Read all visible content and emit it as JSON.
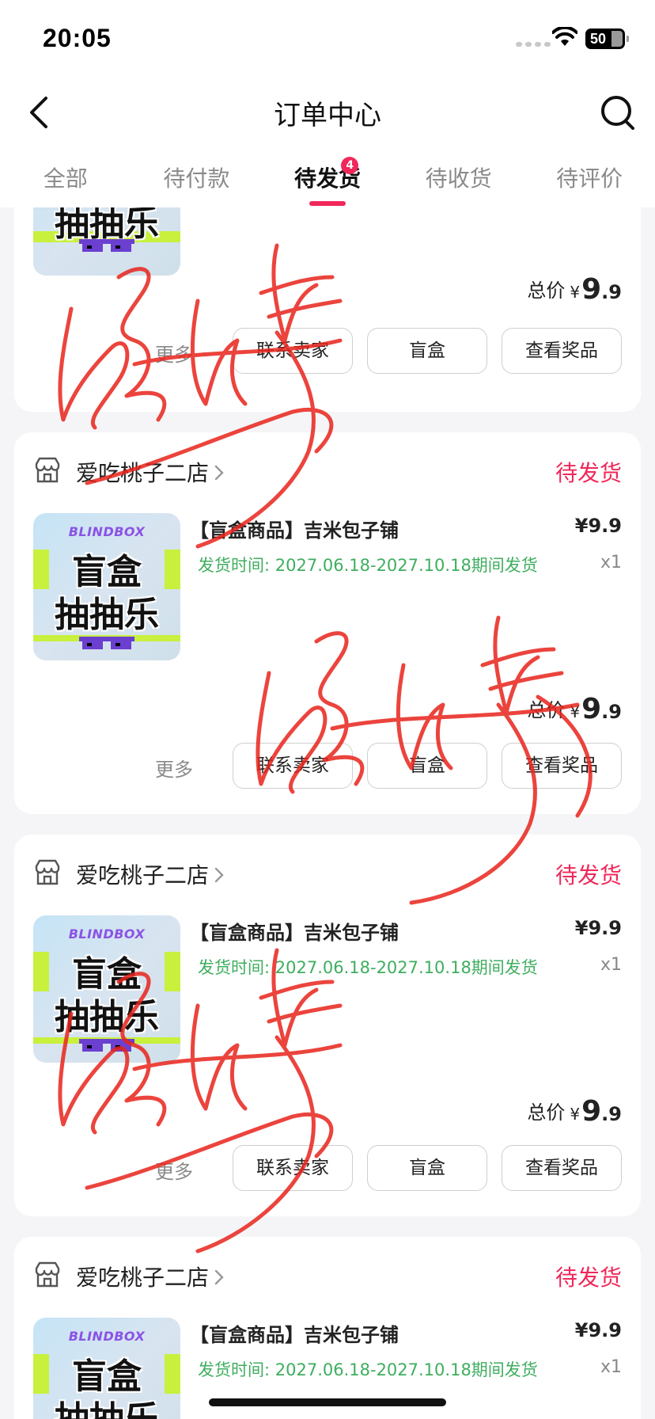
{
  "status_bar": {
    "time": "20:05",
    "battery_level": "50"
  },
  "nav": {
    "title": "订单中心"
  },
  "tabs": [
    {
      "label": "全部",
      "active": false
    },
    {
      "label": "待付款",
      "active": false
    },
    {
      "label": "待发货",
      "active": true,
      "badge": "4"
    },
    {
      "label": "待收货",
      "active": false
    },
    {
      "label": "待评价",
      "active": false
    }
  ],
  "thumb": {
    "brand": "BLINDBOX",
    "line1": "盲盒",
    "line2": "抽抽乐"
  },
  "orders": [
    {
      "total_label": "总价",
      "currency": "¥",
      "total_int": "9",
      "total_dec": ".9",
      "more": "更多",
      "buttons": [
        "联系卖家",
        "盲盒",
        "查看奖品"
      ]
    },
    {
      "shop": "爱吃桃子二店",
      "status": "待发货",
      "title": "【盲盒商品】吉米包子铺",
      "price": "¥9.9",
      "ship_time": "发货时间: 2027.06.18-2027.10.18期间发货",
      "qty": "x1",
      "total_label": "总价",
      "currency": "¥",
      "total_int": "9",
      "total_dec": ".9",
      "more": "更多",
      "buttons": [
        "联系卖家",
        "盲盒",
        "查看奖品"
      ]
    },
    {
      "shop": "爱吃桃子二店",
      "status": "待发货",
      "title": "【盲盒商品】吉米包子铺",
      "price": "¥9.9",
      "ship_time": "发货时间: 2027.06.18-2027.10.18期间发货",
      "qty": "x1",
      "total_label": "总价",
      "currency": "¥",
      "total_int": "9",
      "total_dec": ".9",
      "more": "更多",
      "buttons": [
        "联系卖家",
        "盲盒",
        "查看奖品"
      ]
    },
    {
      "shop": "爱吃桃子二店",
      "status": "待发货",
      "title": "【盲盒商品】吉米包子铺",
      "price": "¥9.9",
      "ship_time": "发货时间: 2027.06.18-2027.10.18期间发货",
      "qty": "x1"
    }
  ],
  "colors": {
    "accent": "#f0285a",
    "ship_green": "#3fae5f",
    "signature_red": "#e8241c"
  }
}
